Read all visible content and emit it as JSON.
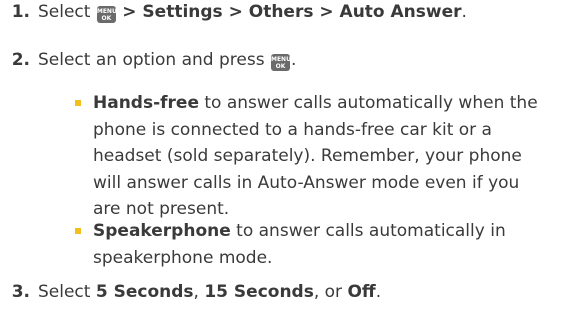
{
  "steps": [
    {
      "number": "1.",
      "text_before": "Select",
      "key_icon": "menu-ok-key",
      "key_line1": "MENU",
      "key_line2": "OK",
      "path": "> Settings > Others > Auto Answer",
      "text_after": "."
    },
    {
      "number": "2.",
      "text_before": "Select an option and press",
      "key_icon": "menu-ok-key",
      "key_line1": "MENU",
      "key_line2": "OK",
      "text_after": "."
    },
    {
      "number": "3.",
      "text_before": "Select",
      "opt1": "5 Seconds",
      "sep1": ",",
      "opt2": "15 Seconds",
      "sep2": ", or",
      "opt3": "Off",
      "text_after": "."
    }
  ],
  "options": [
    {
      "label": "Hands-free",
      "description": "to answer calls automatically when the phone is connected to a hands-free car kit or a headset (sold separately). Remember, your phone will answer calls in Auto-Answer mode even if you are not present."
    },
    {
      "label": "Speakerphone",
      "description": "to answer calls automatically in speakerphone mode."
    }
  ],
  "colors": {
    "text": "#3a3a3a",
    "bullet": "#f2c01e",
    "key": "#6b6b6b"
  }
}
